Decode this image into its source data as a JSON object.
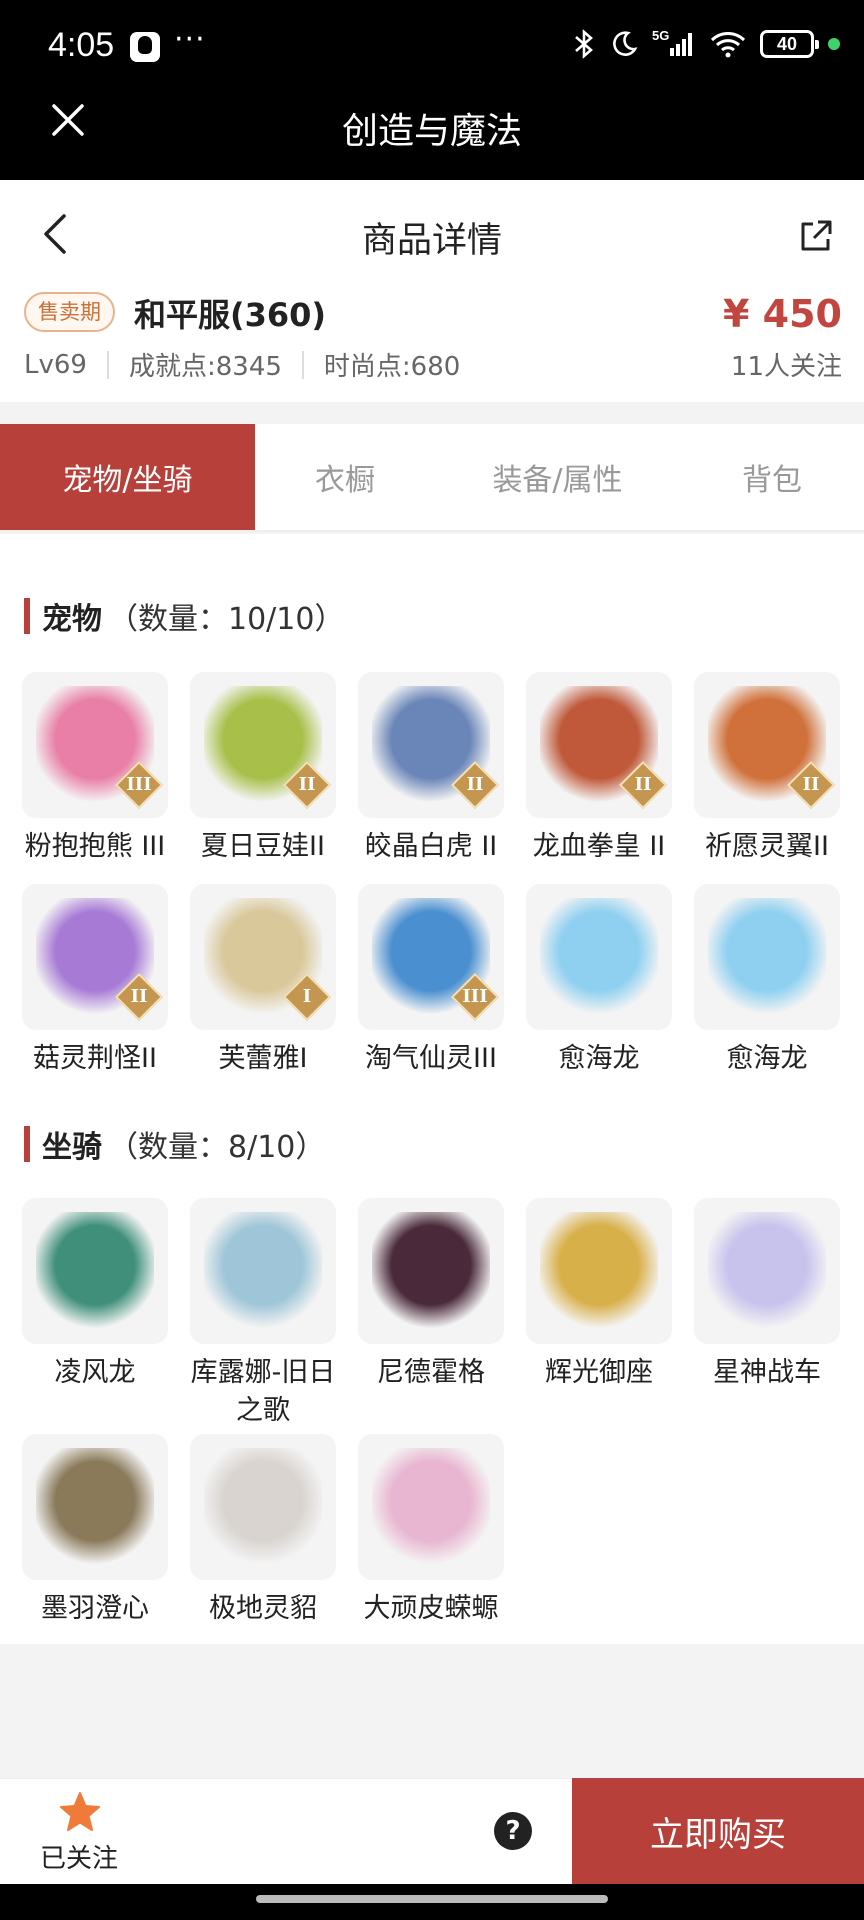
{
  "status_bar": {
    "time": "4:05",
    "dots": "···",
    "network": "5G",
    "battery": "40",
    "icons": [
      "qq-icon",
      "bluetooth-icon",
      "moon-icon",
      "signal-icon",
      "wifi-icon",
      "battery-icon"
    ]
  },
  "webview": {
    "title": "创造与魔法",
    "close_icon": "close-icon"
  },
  "header": {
    "title": "商品详情",
    "back_icon": "back-arrow-icon",
    "share_icon": "share-icon"
  },
  "summary": {
    "status_badge": "售卖期",
    "server": "和平服(360)",
    "price": "¥ 450",
    "level": "Lv69",
    "achievement": "成就点:8345",
    "fashion": "时尚点:680",
    "followers": "11人关注"
  },
  "tabs": [
    {
      "label": "宠物/坐骑",
      "active": true
    },
    {
      "label": "衣橱",
      "active": false
    },
    {
      "label": "装备/属性",
      "active": false
    },
    {
      "label": "背包",
      "active": false
    }
  ],
  "pets": {
    "title": "宠物",
    "count": "（数量：10/10）",
    "items": [
      {
        "name": "粉抱抱熊 III",
        "grade": "III",
        "color": "#e97fa6"
      },
      {
        "name": "夏日豆娃II",
        "grade": "II",
        "color": "#a8c04a"
      },
      {
        "name": "皎晶白虎 II",
        "grade": "II",
        "color": "#6a86b8"
      },
      {
        "name": "龙血拳皇 II",
        "grade": "II",
        "color": "#c0593a"
      },
      {
        "name": "祈愿灵翼II",
        "grade": "II",
        "color": "#d0703a"
      },
      {
        "name": "菇灵荆怪II",
        "grade": "II",
        "color": "#a77ad6"
      },
      {
        "name": "芙蕾雅I",
        "grade": "I",
        "color": "#d9c89a"
      },
      {
        "name": "淘气仙灵III",
        "grade": "III",
        "color": "#4a8fd0"
      },
      {
        "name": "愈海龙",
        "grade": "",
        "color": "#8fd0f0"
      },
      {
        "name": "愈海龙",
        "grade": "",
        "color": "#8fd0f0"
      }
    ]
  },
  "mounts": {
    "title": "坐骑",
    "count": "（数量：8/10）",
    "items": [
      {
        "name": "凌风龙",
        "color": "#3f8f7a"
      },
      {
        "name": "库露娜-旧日之歌",
        "color": "#9fc6d8"
      },
      {
        "name": "尼德霍格",
        "color": "#4a2a3a"
      },
      {
        "name": "辉光御座",
        "color": "#d8b04a"
      },
      {
        "name": "星神战车",
        "color": "#c7c3ec"
      },
      {
        "name": "墨羽澄心",
        "color": "#8a7a5a"
      },
      {
        "name": "极地灵貂",
        "color": "#d9d4cf"
      },
      {
        "name": "大顽皮蝾螈",
        "color": "#e8b6d0"
      }
    ]
  },
  "bottom_bar": {
    "follow_label": "已关注",
    "help": "?",
    "buy_label": "立即购买"
  },
  "colors": {
    "accent": "#b8403b",
    "price": "#c0463f",
    "badge_text": "#c9703a",
    "follow_star": "#f07a3a"
  }
}
